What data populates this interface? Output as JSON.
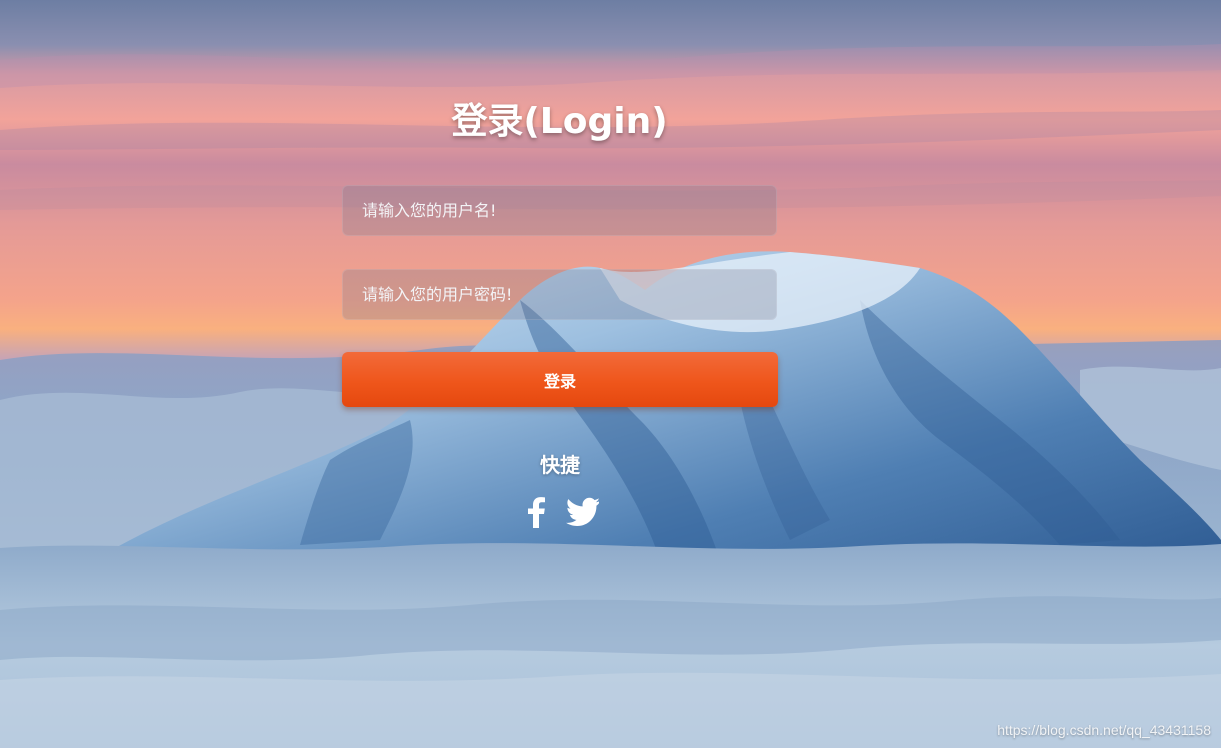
{
  "login": {
    "title": "登录(Login)",
    "username_placeholder": "请输入您的用户名!",
    "password_placeholder": "请输入您的用户密码!",
    "submit_label": "登录",
    "quick_label": "快捷"
  },
  "social": {
    "facebook_icon": "facebook-icon",
    "twitter_icon": "twitter-icon"
  },
  "watermark": "https://blog.csdn.net/qq_43431158",
  "colors": {
    "button": "#ef561b",
    "text": "#ffffff"
  }
}
